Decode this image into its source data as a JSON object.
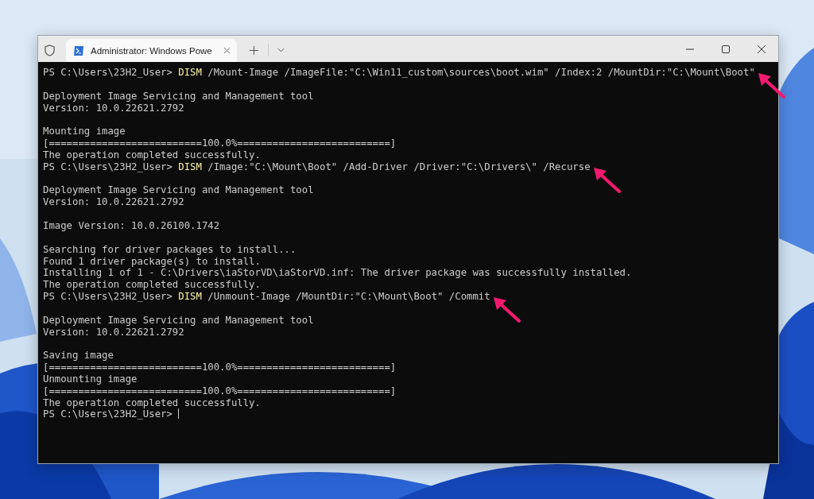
{
  "window": {
    "tabs": [
      {
        "title": "Administrator: Windows Powe",
        "selected": true
      }
    ]
  },
  "terminal": {
    "lines": [
      {
        "kind": "command",
        "prompt": "PS C:\\Users\\23H2_User>",
        "program": "DISM",
        "args": "/Mount-Image /ImageFile:\"C:\\Win11_custom\\sources\\boot.wim\" /Index:2 /MountDir:\"C:\\Mount\\Boot\"",
        "annotated": true
      },
      {
        "kind": "blank"
      },
      {
        "kind": "output",
        "text": "Deployment Image Servicing and Management tool"
      },
      {
        "kind": "output",
        "text": "Version: 10.0.22621.2792"
      },
      {
        "kind": "blank"
      },
      {
        "kind": "output",
        "text": "Mounting image"
      },
      {
        "kind": "output",
        "text": "[==========================100.0%==========================]"
      },
      {
        "kind": "output",
        "text": "The operation completed successfully."
      },
      {
        "kind": "command",
        "prompt": "PS C:\\Users\\23H2_User>",
        "program": "DISM",
        "args": "/Image:\"C:\\Mount\\Boot\" /Add-Driver /Driver:\"C:\\Drivers\\\" /Recurse",
        "annotated": true
      },
      {
        "kind": "blank"
      },
      {
        "kind": "output",
        "text": "Deployment Image Servicing and Management tool"
      },
      {
        "kind": "output",
        "text": "Version: 10.0.22621.2792"
      },
      {
        "kind": "blank"
      },
      {
        "kind": "output",
        "text": "Image Version: 10.0.26100.1742"
      },
      {
        "kind": "blank"
      },
      {
        "kind": "output",
        "text": "Searching for driver packages to install..."
      },
      {
        "kind": "output",
        "text": "Found 1 driver package(s) to install."
      },
      {
        "kind": "output",
        "text": "Installing 1 of 1 - C:\\Drivers\\iaStorVD\\iaStorVD.inf: The driver package was successfully installed."
      },
      {
        "kind": "output",
        "text": "The operation completed successfully."
      },
      {
        "kind": "command",
        "prompt": "PS C:\\Users\\23H2_User>",
        "program": "DISM",
        "args": "/Unmount-Image /MountDir:\"C:\\Mount\\Boot\" /Commit",
        "annotated": true
      },
      {
        "kind": "blank"
      },
      {
        "kind": "output",
        "text": "Deployment Image Servicing and Management tool"
      },
      {
        "kind": "output",
        "text": "Version: 10.0.22621.2792"
      },
      {
        "kind": "blank"
      },
      {
        "kind": "output",
        "text": "Saving image"
      },
      {
        "kind": "output",
        "text": "[==========================100.0%==========================]"
      },
      {
        "kind": "output",
        "text": "Unmounting image"
      },
      {
        "kind": "output",
        "text": "[==========================100.0%==========================]"
      },
      {
        "kind": "output",
        "text": "The operation completed successfully."
      },
      {
        "kind": "prompt",
        "prompt": "PS C:\\Users\\23H2_User>",
        "cursor": true
      }
    ]
  }
}
